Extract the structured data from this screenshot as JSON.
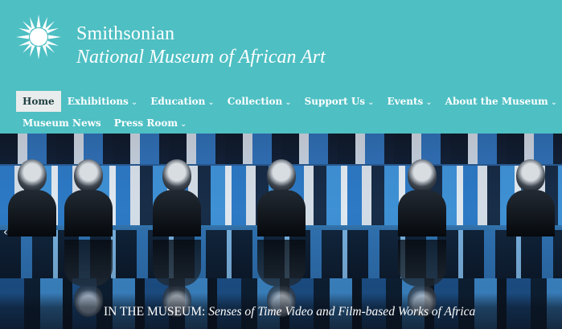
{
  "header": {
    "logo": "smithsonian-sunburst-icon",
    "brand_line1": "Smithsonian",
    "brand_line2": "National Museum of African Art"
  },
  "nav": {
    "row1": [
      {
        "label": "Home",
        "active": true,
        "dropdown": false
      },
      {
        "label": "Exhibitions",
        "dropdown": true
      },
      {
        "label": "Education",
        "dropdown": true
      },
      {
        "label": "Collection",
        "dropdown": true
      },
      {
        "label": "Support Us",
        "dropdown": true
      },
      {
        "label": "Events",
        "dropdown": true
      },
      {
        "label": "About the Museum",
        "dropdown": true
      }
    ],
    "row2": [
      {
        "label": "Museum News",
        "dropdown": false
      },
      {
        "label": "Press Room",
        "dropdown": true
      }
    ],
    "caret": "⌄"
  },
  "hero": {
    "prev_arrow": "‹",
    "caption_prefix": "IN THE MUSEUM:",
    "caption_title": "Senses of Time Video and Film-based Works of Africa"
  },
  "colors": {
    "header_bg": "#4ebfc3",
    "active_tab_bg": "#e9ecec",
    "text_white": "#ffffff"
  }
}
